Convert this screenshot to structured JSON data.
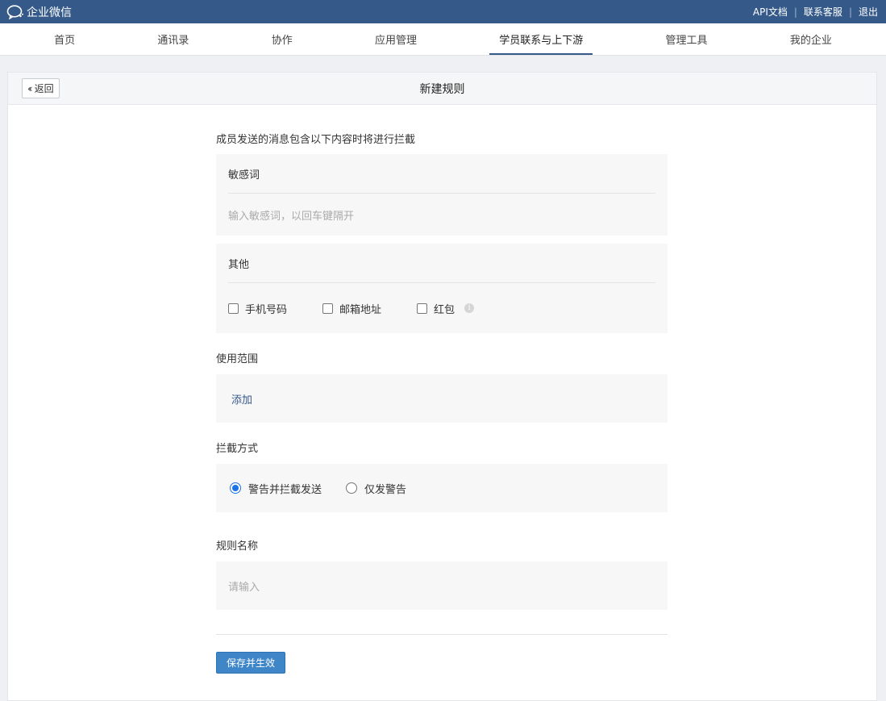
{
  "app": {
    "brand": "企业微信"
  },
  "toplinks": {
    "api_docs": "API文档",
    "contact_support": "联系客服",
    "logout": "退出"
  },
  "nav": {
    "items": [
      {
        "label": "首页"
      },
      {
        "label": "通讯录"
      },
      {
        "label": "协作"
      },
      {
        "label": "应用管理"
      },
      {
        "label": "学员联系与上下游"
      },
      {
        "label": "管理工具"
      },
      {
        "label": "我的企业"
      }
    ],
    "active_index": 4
  },
  "page": {
    "back_label": "返回",
    "title": "新建规则"
  },
  "form": {
    "intro": "成员发送的消息包含以下内容时将进行拦截",
    "sensitive": {
      "title": "敏感词",
      "placeholder": "输入敏感词，以回车键隔开"
    },
    "other": {
      "title": "其他",
      "options": [
        {
          "label": "手机号码",
          "checked": false
        },
        {
          "label": "邮箱地址",
          "checked": false
        },
        {
          "label": "红包",
          "checked": false
        }
      ]
    },
    "scope": {
      "label": "使用范围",
      "add_label": "添加"
    },
    "method": {
      "label": "拦截方式",
      "options": [
        {
          "label": "警告并拦截发送",
          "checked": true
        },
        {
          "label": "仅发警告",
          "checked": false
        }
      ]
    },
    "rule_name": {
      "label": "规则名称",
      "placeholder": "请输入"
    },
    "save_label": "保存并生效"
  },
  "colors": {
    "topbar": "#355a8a",
    "accent": "#1a73e8",
    "button": "#3f86c9"
  }
}
